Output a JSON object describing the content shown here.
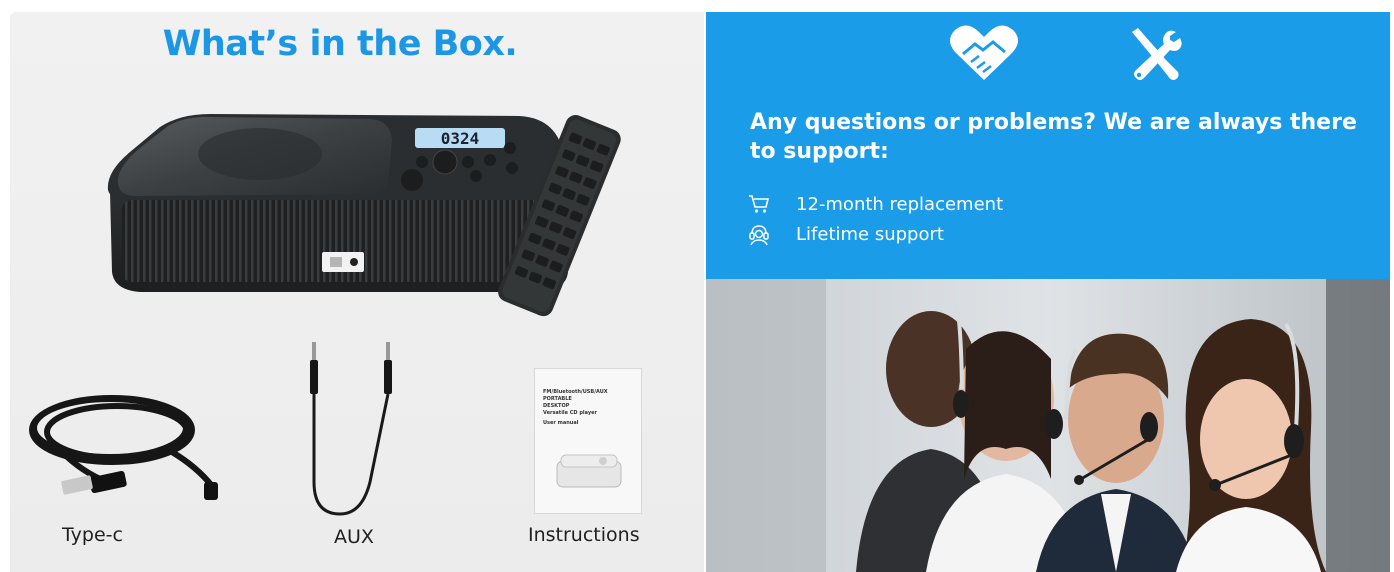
{
  "left_panel": {
    "title": "What’s in the Box.",
    "display_digits": "0324",
    "captions": {
      "type_c": "Type-c",
      "aux": "AUX",
      "instructions": "Instructions"
    },
    "manual_text": {
      "line1": "FM/Bluetooth/USB/AUX",
      "line2": "PORTABLE",
      "line3": "DESKTOP",
      "line4": "Versatile CD player",
      "line5": "User manual"
    }
  },
  "right_panel": {
    "headline": "Any questions or problems? We are always there to support:",
    "services": [
      {
        "icon": "cart-icon",
        "label": "12-month replacement"
      },
      {
        "icon": "headset-support-icon",
        "label": "Lifetime support"
      }
    ],
    "top_icons": [
      "handshake-heart-icon",
      "tools-icon"
    ]
  },
  "colors": {
    "brand_blue": "#1a9ce8",
    "title_blue": "#1c97e6"
  }
}
